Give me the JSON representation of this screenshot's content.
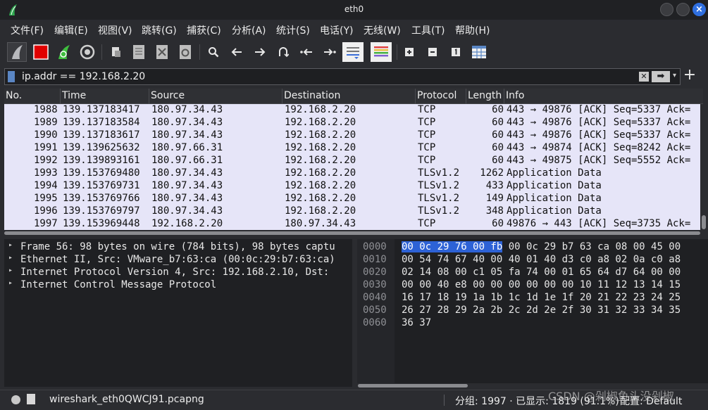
{
  "window": {
    "title": "eth0",
    "close_glyph": "×"
  },
  "menu": [
    {
      "label": "文件(F)"
    },
    {
      "label": "编辑(E)"
    },
    {
      "label": "视图(V)"
    },
    {
      "label": "跳转(G)"
    },
    {
      "label": "捕获(C)"
    },
    {
      "label": "分析(A)"
    },
    {
      "label": "统计(S)"
    },
    {
      "label": "电话(Y)"
    },
    {
      "label": "无线(W)"
    },
    {
      "label": "工具(T)"
    },
    {
      "label": "帮助(H)"
    }
  ],
  "filter": {
    "value": "ip.addr == 192.168.2.20",
    "clear_glyph": "✕",
    "apply_glyph": "➡",
    "dropdown_glyph": "▾",
    "add_glyph": "+"
  },
  "columns": [
    "No.",
    "Time",
    "Source",
    "Destination",
    "Protocol",
    "Length",
    "Info"
  ],
  "packets": [
    {
      "no": "1988",
      "time": "139.137183417",
      "src": "180.97.34.43",
      "dst": "192.168.2.20",
      "proto": "TCP",
      "len": "60",
      "info": "443 → 49876 [ACK] Seq=5337 Ack="
    },
    {
      "no": "1989",
      "time": "139.137183584",
      "src": "180.97.34.43",
      "dst": "192.168.2.20",
      "proto": "TCP",
      "len": "60",
      "info": "443 → 49876 [ACK] Seq=5337 Ack="
    },
    {
      "no": "1990",
      "time": "139.137183617",
      "src": "180.97.34.43",
      "dst": "192.168.2.20",
      "proto": "TCP",
      "len": "60",
      "info": "443 → 49876 [ACK] Seq=5337 Ack="
    },
    {
      "no": "1991",
      "time": "139.139625632",
      "src": "180.97.66.31",
      "dst": "192.168.2.20",
      "proto": "TCP",
      "len": "60",
      "info": "443 → 49874 [ACK] Seq=8242 Ack="
    },
    {
      "no": "1992",
      "time": "139.139893161",
      "src": "180.97.66.31",
      "dst": "192.168.2.20",
      "proto": "TCP",
      "len": "60",
      "info": "443 → 49875 [ACK] Seq=5552 Ack="
    },
    {
      "no": "1993",
      "time": "139.153769480",
      "src": "180.97.34.43",
      "dst": "192.168.2.20",
      "proto": "TLSv1.2",
      "len": "1262",
      "info": "Application Data"
    },
    {
      "no": "1994",
      "time": "139.153769731",
      "src": "180.97.34.43",
      "dst": "192.168.2.20",
      "proto": "TLSv1.2",
      "len": "433",
      "info": "Application Data"
    },
    {
      "no": "1995",
      "time": "139.153769766",
      "src": "180.97.34.43",
      "dst": "192.168.2.20",
      "proto": "TLSv1.2",
      "len": "149",
      "info": "Application Data"
    },
    {
      "no": "1996",
      "time": "139.153769797",
      "src": "180.97.34.43",
      "dst": "192.168.2.20",
      "proto": "TLSv1.2",
      "len": "348",
      "info": "Application Data"
    },
    {
      "no": "1997",
      "time": "139.153969448",
      "src": "192.168.2.20",
      "dst": "180.97.34.43",
      "proto": "TCP",
      "len": "60",
      "info": "49876 → 443 [ACK] Seq=3735 Ack="
    }
  ],
  "details": [
    {
      "arrow": "▸",
      "text": "Frame 56: 98 bytes on wire (784 bits), 98 bytes captu"
    },
    {
      "arrow": "▸",
      "text": "Ethernet II, Src: VMware_b7:63:ca (00:0c:29:b7:63:ca)"
    },
    {
      "arrow": "▸",
      "text": "Internet Protocol Version 4, Src: 192.168.2.10, Dst:"
    },
    {
      "arrow": "▸",
      "text": "Internet Control Message Protocol"
    }
  ],
  "bytes": [
    {
      "offset": "0000",
      "highlight": "00 0c 29 76 00 fb",
      "rest": " 00 0c  29 b7 63 ca 08 00 45 00"
    },
    {
      "offset": "0010",
      "highlight": "",
      "rest": "00 54 74 67 40 00 40 01  40 d3 c0 a8 02 0a c0 a8"
    },
    {
      "offset": "0020",
      "highlight": "",
      "rest": "02 14 08 00 c1 05 fa 74  00 01 65 64 d7 64 00 00"
    },
    {
      "offset": "0030",
      "highlight": "",
      "rest": "00 00 40 e8 00 00 00 00  00 00 10 11 12 13 14 15"
    },
    {
      "offset": "0040",
      "highlight": "",
      "rest": "16 17 18 19 1a 1b 1c 1d  1e 1f 20 21 22 23 24 25"
    },
    {
      "offset": "0050",
      "highlight": "",
      "rest": "26 27 28 29 2a 2b 2c 2d  2e 2f 30 31 32 33 34 35"
    },
    {
      "offset": "0060",
      "highlight": "",
      "rest": "36 37"
    }
  ],
  "status": {
    "file": "wireshark_eth0QWCJ91.pcapng",
    "stats": "分组: 1997 · 已显示: 1819 (91.1%)",
    "profile": "配置: Default"
  },
  "watermark": "CSDN @剁椒鱼头没剁椒",
  "colors": {
    "accent": "#2d62d6",
    "row_bg": "#e6e5f8",
    "stop_red": "#e00000",
    "shark_green": "#3fbf3f"
  }
}
